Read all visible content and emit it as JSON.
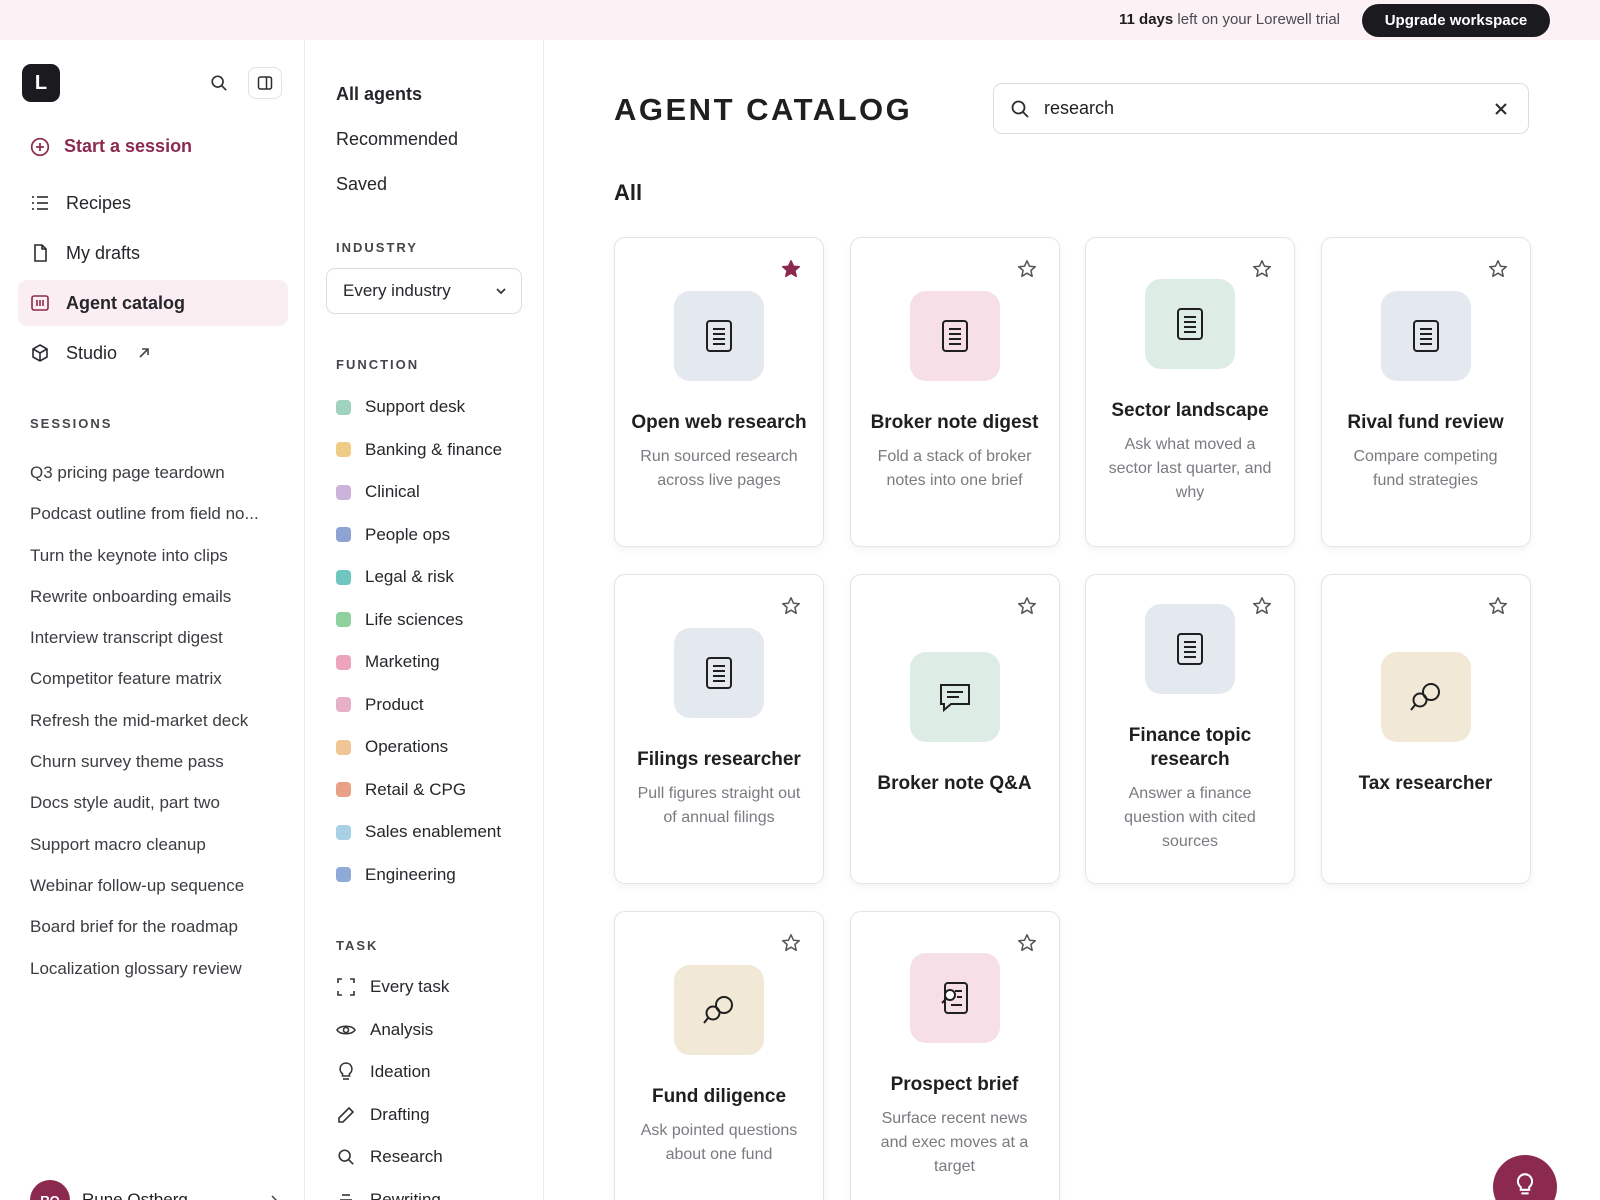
{
  "banner": {
    "trial_days": "11 days",
    "trial_rest": " left on your Lorewell trial",
    "upgrade_label": "Upgrade workspace"
  },
  "sidebar": {
    "logo_letter": "L",
    "start_session": "Start a session",
    "nav": [
      {
        "label": "Recipes",
        "icon": "list-icon"
      },
      {
        "label": "My drafts",
        "icon": "document-icon"
      },
      {
        "label": "Agent catalog",
        "icon": "catalog-icon",
        "active": true
      },
      {
        "label": "Studio",
        "icon": "cube-icon",
        "external": true
      }
    ],
    "sessions_label": "SESSIONS",
    "sessions": [
      "Q3 pricing page teardown",
      "Podcast outline from field no...",
      "Turn the keynote into clips",
      "Rewrite onboarding emails",
      "Interview transcript digest",
      "Competitor feature matrix",
      "Refresh the mid-market deck",
      "Churn survey theme pass",
      "Docs style audit, part two",
      "Support macro cleanup",
      "Webinar follow-up sequence",
      "Board brief for the roadmap",
      "Localization glossary review"
    ],
    "user": {
      "initials": "RO",
      "name": "Rune Ostberg"
    }
  },
  "filters": {
    "top": [
      "All agents",
      "Recommended",
      "Saved"
    ],
    "industry_label": "INDUSTRY",
    "industry_value": "Every industry",
    "function_label": "FUNCTION",
    "functions": [
      {
        "label": "Support desk",
        "color": "#9fd3bf"
      },
      {
        "label": "Banking & finance",
        "color": "#f0cd86"
      },
      {
        "label": "Clinical",
        "color": "#cbb3dc"
      },
      {
        "label": "People ops",
        "color": "#8ea3d4"
      },
      {
        "label": "Legal & risk",
        "color": "#6fc6c0"
      },
      {
        "label": "Life sciences",
        "color": "#8fd09f"
      },
      {
        "label": "Marketing",
        "color": "#eca5bd"
      },
      {
        "label": "Product",
        "color": "#e6b0c7"
      },
      {
        "label": "Operations",
        "color": "#f2c596"
      },
      {
        "label": "Retail & CPG",
        "color": "#e8a184"
      },
      {
        "label": "Sales enablement",
        "color": "#a9d1e6"
      },
      {
        "label": "Engineering",
        "color": "#8fa9d8"
      }
    ],
    "task_label": "TASK",
    "tasks": [
      {
        "label": "Every task",
        "icon": "expand-icon"
      },
      {
        "label": "Analysis",
        "icon": "eye-icon"
      },
      {
        "label": "Ideation",
        "icon": "lightbulb-icon"
      },
      {
        "label": "Drafting",
        "icon": "pencil-icon"
      },
      {
        "label": "Research",
        "icon": "search-icon"
      },
      {
        "label": "Rewriting",
        "icon": "lines-icon"
      }
    ]
  },
  "main": {
    "title": "AGENT CATALOG",
    "search_value": "research",
    "group_title": "All",
    "cards": [
      {
        "title": "Open web research",
        "desc": "Run sourced research across live pages",
        "icon": "document-icon",
        "bg": "#e3e9ef",
        "starred": true
      },
      {
        "title": "Broker note digest",
        "desc": "Fold a stack of broker notes into one brief",
        "icon": "document-icon",
        "bg": "#f6dfe6",
        "starred": false
      },
      {
        "title": "Sector landscape",
        "desc": "Ask what moved a sector last quarter, and why",
        "icon": "document-icon",
        "bg": "#ddece4",
        "starred": false
      },
      {
        "title": "Rival fund review",
        "desc": "Compare competing fund strategies",
        "icon": "document-icon",
        "bg": "#e3e9ef",
        "starred": false
      },
      {
        "title": "Filings researcher",
        "desc": "Pull figures straight out of annual filings",
        "icon": "document-icon",
        "bg": "#e3e9ef",
        "starred": false
      },
      {
        "title": "Broker note Q&A",
        "desc": "",
        "icon": "chat-icon",
        "bg": "#ddece4",
        "starred": false
      },
      {
        "title": "Finance topic research",
        "desc": "Answer a finance question with cited sources",
        "icon": "document-icon",
        "bg": "#e3e9ef",
        "starred": false
      },
      {
        "title": "Tax researcher",
        "desc": "",
        "icon": "discuss-icon",
        "bg": "#f2e8d6",
        "starred": false
      },
      {
        "title": "Fund diligence",
        "desc": "Ask pointed questions about one fund",
        "icon": "discuss-icon",
        "bg": "#f2e8d6",
        "starred": false
      },
      {
        "title": "Prospect brief",
        "desc": "Surface recent news and exec moves at a target",
        "icon": "doc-search-icon",
        "bg": "#f6dfe6",
        "starred": false
      }
    ]
  },
  "colors": {
    "brand": "#8b2a4e",
    "dark": "#1b1b1f",
    "banner_bg": "#fcf1f4"
  }
}
